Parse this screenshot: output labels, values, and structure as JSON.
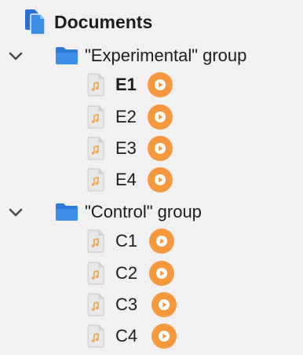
{
  "tree": {
    "root": {
      "label": "Documents",
      "icon": "documents-stack-icon"
    },
    "groups": [
      {
        "label": "\"Experimental\" group",
        "expanded": true,
        "icon": "folder-icon",
        "files": [
          {
            "label": "E1",
            "selected": true,
            "icon": "audio-file-icon",
            "action_icon": "play-icon"
          },
          {
            "label": "E2",
            "selected": false,
            "icon": "audio-file-icon",
            "action_icon": "play-icon"
          },
          {
            "label": "E3",
            "selected": false,
            "icon": "audio-file-icon",
            "action_icon": "play-icon"
          },
          {
            "label": "E4",
            "selected": false,
            "icon": "audio-file-icon",
            "action_icon": "play-icon"
          }
        ]
      },
      {
        "label": "\"Control\" group",
        "expanded": true,
        "icon": "folder-icon",
        "files": [
          {
            "label": "C1",
            "selected": false,
            "icon": "audio-file-icon",
            "action_icon": "play-icon"
          },
          {
            "label": "C2",
            "selected": false,
            "icon": "audio-file-icon",
            "action_icon": "play-icon"
          },
          {
            "label": "C3",
            "selected": false,
            "icon": "audio-file-icon",
            "action_icon": "play-icon"
          },
          {
            "label": "C4",
            "selected": false,
            "icon": "audio-file-icon",
            "action_icon": "play-icon"
          }
        ]
      }
    ]
  },
  "colors": {
    "background": "#f2f1f1",
    "folder_blue": "#3d8fe6",
    "play_orange": "#f6993e",
    "file_icon_orange": "#f0a24a",
    "text": "#1d1d1f"
  }
}
